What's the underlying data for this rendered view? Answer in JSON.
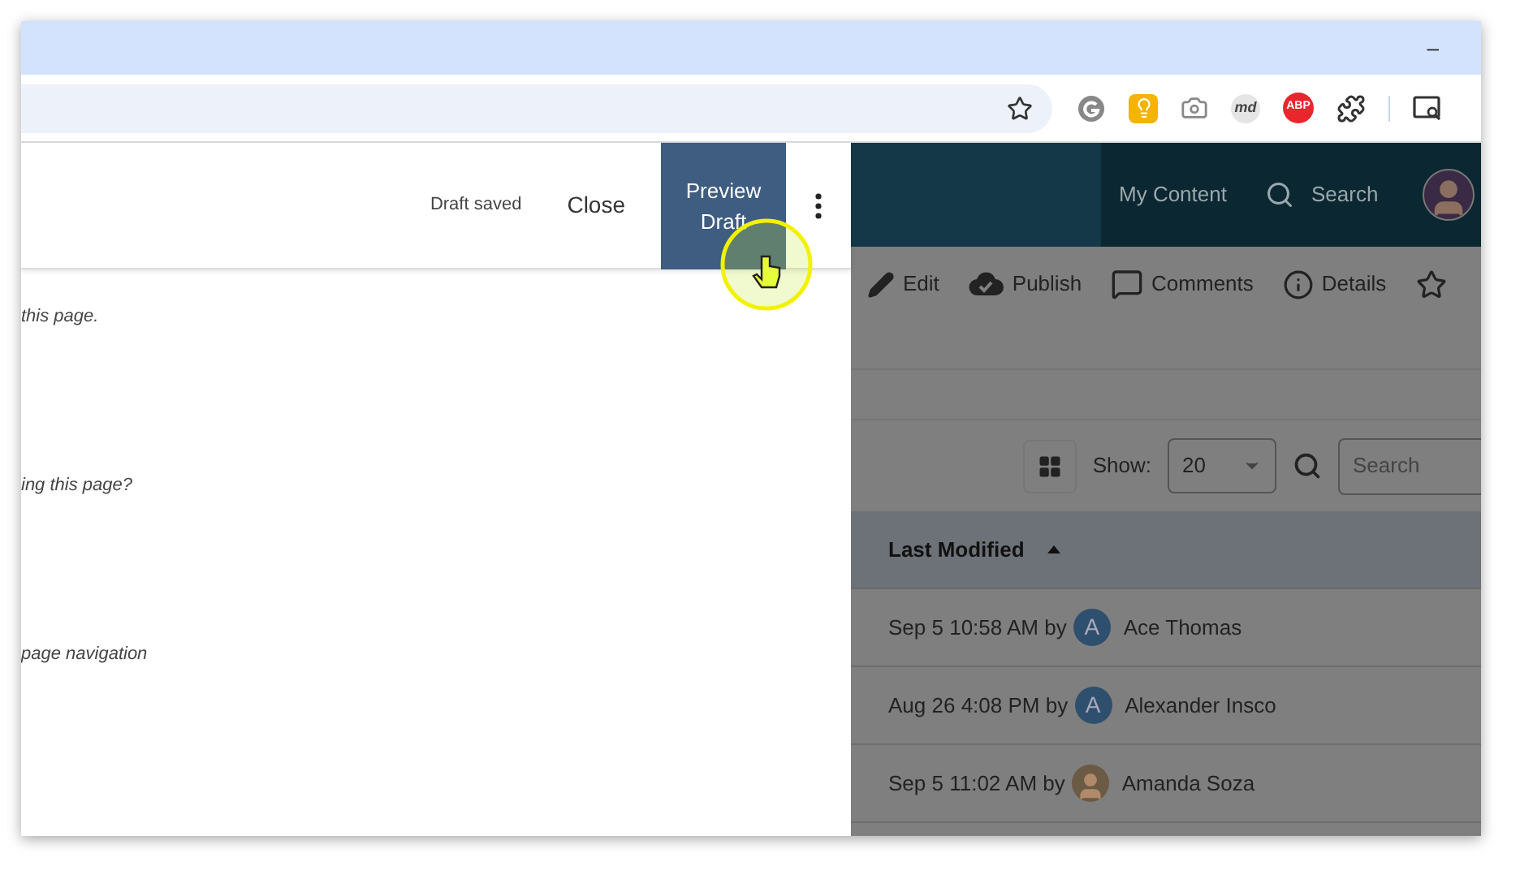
{
  "browser": {
    "minimize": "–",
    "extensions": [
      {
        "kind": "g"
      },
      {
        "kind": "bulb"
      },
      {
        "kind": "camera"
      },
      {
        "kind": "badge",
        "label": "md"
      },
      {
        "kind": "abp",
        "label": "ABP"
      },
      {
        "kind": "puzzle"
      },
      {
        "kind": "sep"
      },
      {
        "kind": "tabsearch"
      }
    ]
  },
  "editor": {
    "status": "Draft saved",
    "close": "Close",
    "preview": "Preview Draft",
    "notes": [
      "this page.",
      "ing this page?",
      "page navigation"
    ]
  },
  "app": {
    "nav": [
      "My Content",
      "Search"
    ],
    "actions": [
      {
        "kind": "edit",
        "label": "Edit"
      },
      {
        "kind": "publish",
        "label": "Publish"
      },
      {
        "kind": "comments",
        "label": "Comments"
      },
      {
        "kind": "details",
        "label": "Details"
      },
      {
        "kind": "star"
      }
    ],
    "show_label": "Show:",
    "page_size": "20",
    "search_placeholder": "Search",
    "table": {
      "column": "Last Modified",
      "rows": [
        {
          "modified": "Sep 5 10:58 AM by",
          "avatar": {
            "kind": "initial",
            "initial": "A"
          },
          "user": "Ace Thomas"
        },
        {
          "modified": "Aug 26 4:08 PM by",
          "avatar": {
            "kind": "initial",
            "initial": "A"
          },
          "user": "Alexander Insco"
        },
        {
          "modified": "Sep 5 11:02 AM by",
          "avatar": {
            "kind": "photo"
          },
          "user": "Amanda Soza"
        }
      ]
    }
  }
}
